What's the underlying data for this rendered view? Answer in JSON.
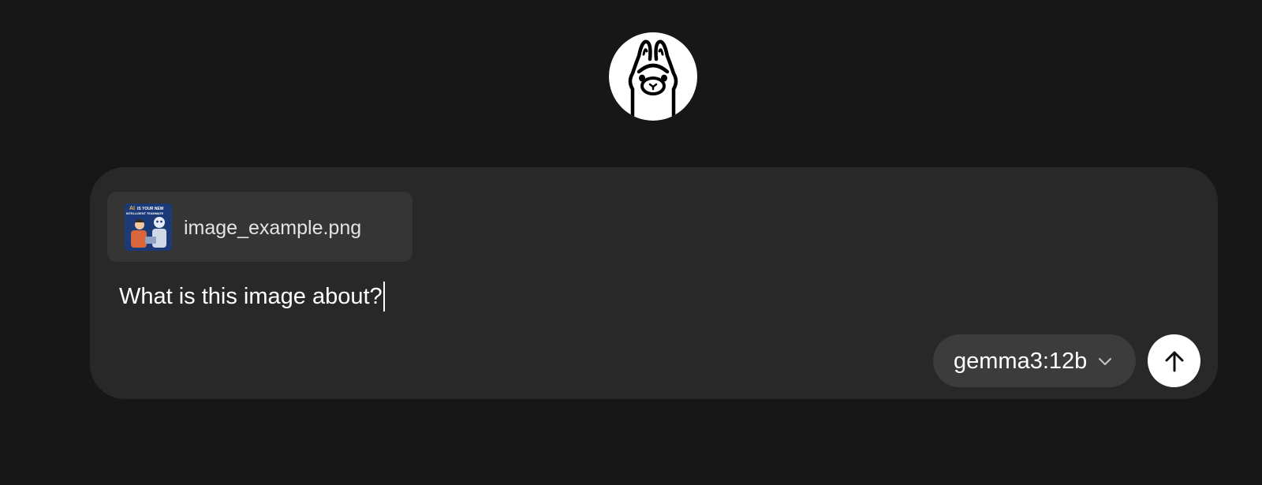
{
  "app": {
    "logo": "ollama-llama-logo"
  },
  "composer": {
    "attachment": {
      "file_name": "image_example.png",
      "thumbnail_text": [
        "AI",
        "IS YOUR NEW",
        "INTELLIGENT TEAMMATE"
      ]
    },
    "prompt_text": "What is this image about?",
    "model_selector": {
      "selected": "gemma3:12b",
      "icon": "chevron-down-icon"
    },
    "send_button": {
      "icon": "arrow-up-icon"
    }
  },
  "colors": {
    "background": "#171717",
    "composer": "#282828",
    "attachment_chip": "#353535",
    "model_pill": "#3c3c3c",
    "send_button": "#ffffff"
  }
}
